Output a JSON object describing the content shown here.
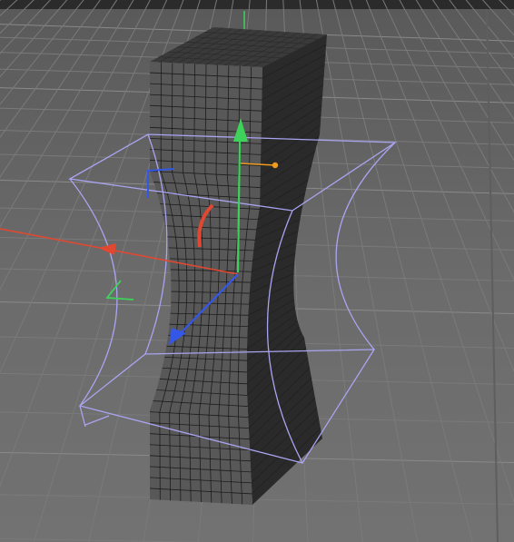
{
  "viewport": {
    "label": "",
    "background_color": "#6b6b6b",
    "grid_color": "#7a7a7a",
    "grid_highlight_color": "#8a8a8a"
  },
  "object": {
    "type": "box-mesh",
    "deformer": "pinch-deformer",
    "front_color": "#585858",
    "side_color": "#2a2a2a",
    "top_color": "#3a3a3a",
    "wire_color": "#1c1c1c"
  },
  "deformer_cage": {
    "color": "#a9a4f0"
  },
  "gizmo": {
    "x_axis_color": "#e04832",
    "y_axis_color": "#3fd25a",
    "z_axis_color": "#3557e8",
    "handle_color": "#f09a1e",
    "x_axis_icon": "arrow-head-icon",
    "y_axis_icon": "arrow-head-icon",
    "z_axis_icon": "arrow-head-icon"
  }
}
